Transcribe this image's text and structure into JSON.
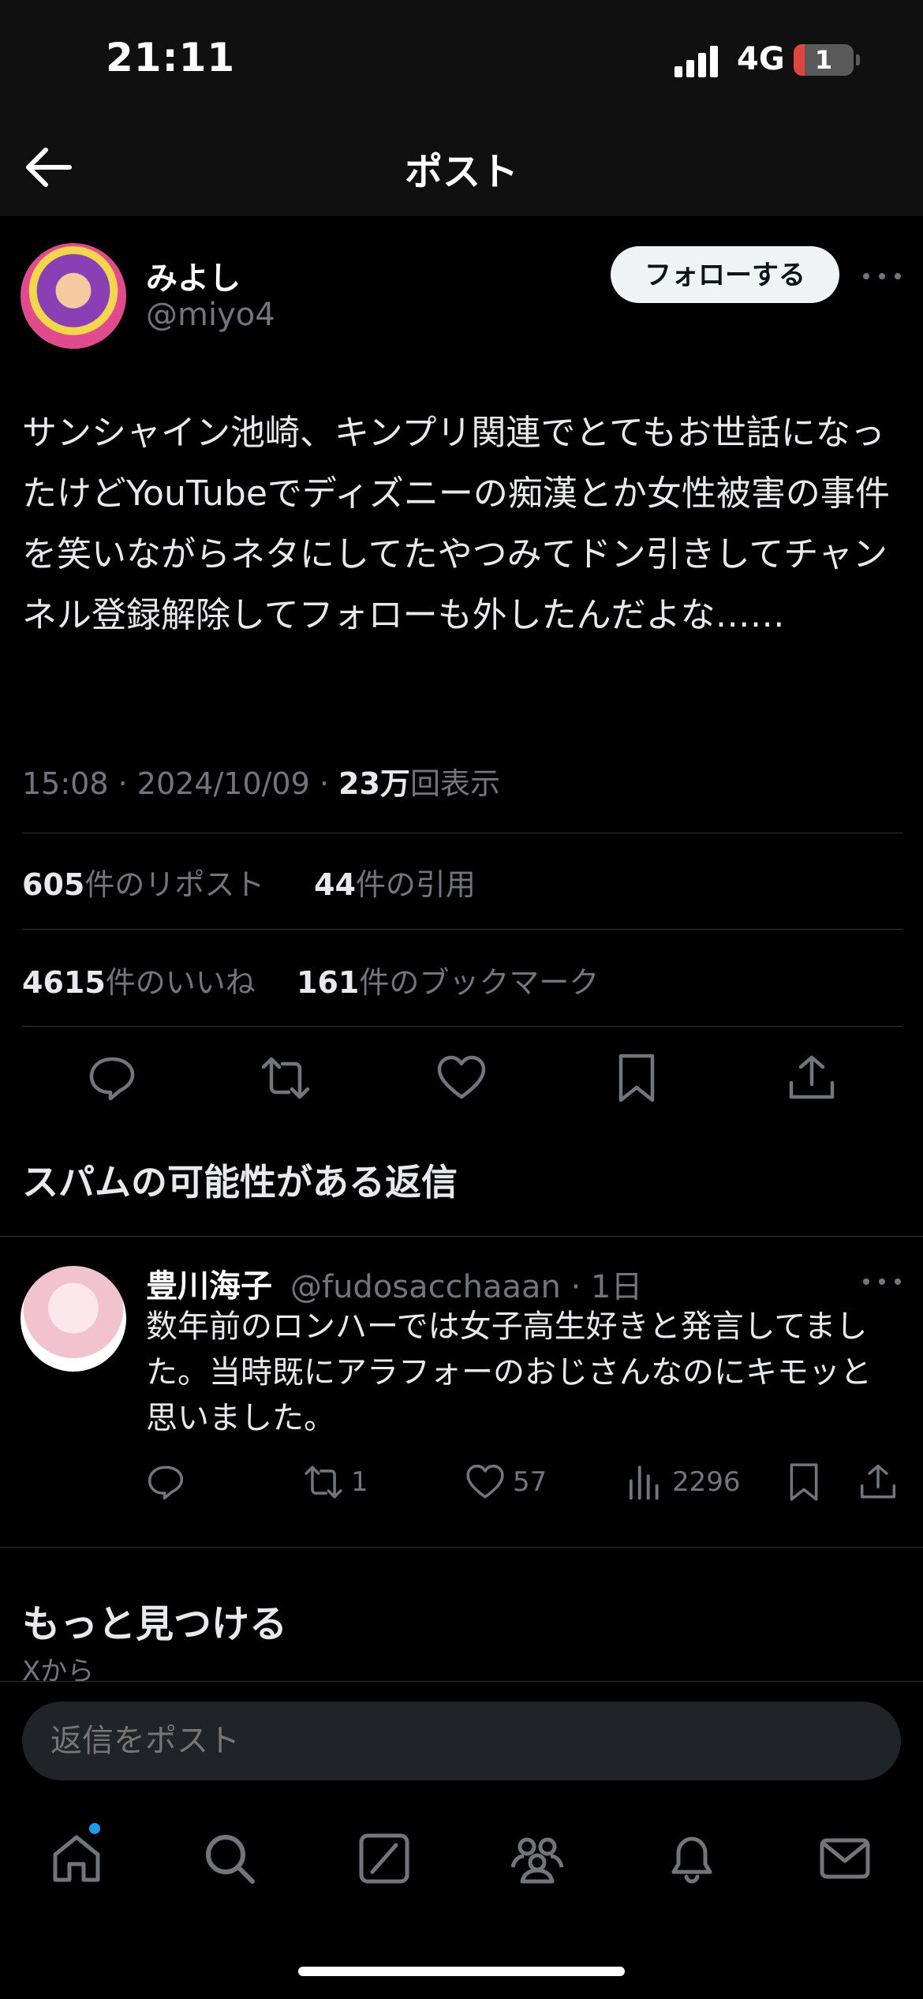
{
  "status_bar": {
    "time": "21:11",
    "network": "4G",
    "battery": "1"
  },
  "nav": {
    "title": "ポスト"
  },
  "post": {
    "author_name": "みよし",
    "author_handle": "@miyo4",
    "follow_label": "フォローする",
    "text": "サンシャイン池崎、キンプリ関連でとてもお世話になったけどYouTubeでディズニーの痴漢とか女性被害の事件を笑いながらネタにしてたやつみてドン引きしてチャンネル登録解除してフォローも外したんだよな……",
    "time": "15:08",
    "date": "2024/10/09",
    "views_count": "23万",
    "views_label": "回表示",
    "reposts_count": "605",
    "reposts_label": "件のリポスト",
    "quotes_count": "44",
    "quotes_label": "件の引用",
    "likes_count": "4615",
    "likes_label": "件のいいね",
    "bookmarks_count": "161",
    "bookmarks_label": "件のブックマーク"
  },
  "section_title": "スパムの可能性がある返信",
  "reply": {
    "author_name": "豊川海子",
    "author_handle": "@fudosacchaaan",
    "age": "· 1日",
    "text": "数年前のロンハーでは女子高生好きと発言してました。当時既にアラフォーのおじさんなのにキモッと思いました。",
    "reposts": "1",
    "likes": "57",
    "views": "2296"
  },
  "discover": {
    "title": "もっと見つける",
    "subtitle": "Xから"
  },
  "composer": {
    "placeholder": "返信をポスト"
  },
  "colors": {
    "accent": "#1d9bf0",
    "muted": "#71767b",
    "divider": "#2f3336"
  },
  "icons": [
    "back-arrow-icon",
    "reply-icon",
    "repost-icon",
    "like-icon",
    "bookmark-icon",
    "share-icon",
    "views-icon",
    "home-icon",
    "search-icon",
    "compose-icon",
    "communities-icon",
    "notifications-icon",
    "messages-icon"
  ]
}
